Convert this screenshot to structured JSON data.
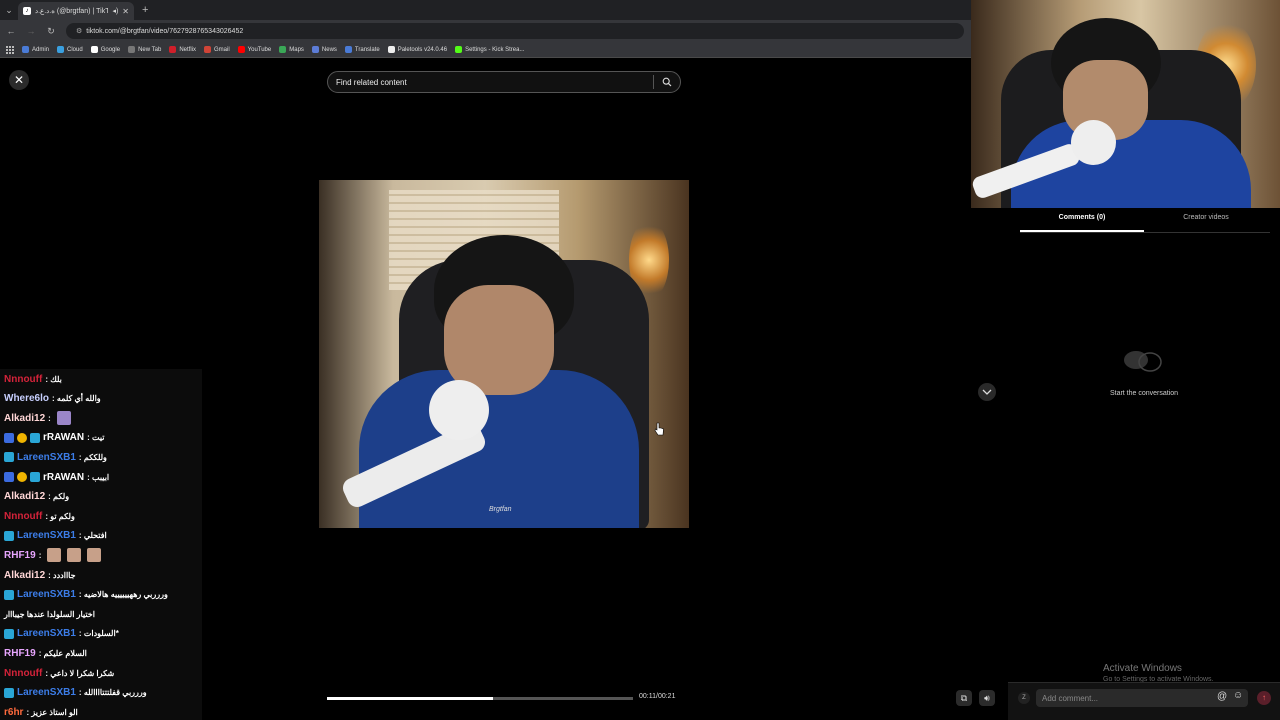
{
  "browser": {
    "tab_title": "ه.د.ع.د (@brgtfan) | TikTok",
    "url": "tiktok.com/@brgtfan/video/7627928765343026452",
    "bookmarks": [
      "Admin",
      "Cloud",
      "Google",
      "New Tab",
      "Netflix",
      "Gmail",
      "YouTube",
      "Maps",
      "News",
      "Translate",
      "Paletools v24.0.46",
      "Settings - Kick Strea..."
    ],
    "bookmark_colors": [
      "#4a7bd6",
      "#3aa0e0",
      "#ffffff",
      "#777777",
      "#d01f2a",
      "#d04437",
      "#ff0000",
      "#3aa757",
      "#5c7cd6",
      "#4a7bd6",
      "#eeeeee",
      "#53fc18"
    ]
  },
  "search": {
    "placeholder": "Find related content"
  },
  "video": {
    "watermark": "Brgtfan",
    "time": "00:11/00:21",
    "progress": 0.543
  },
  "chat": [
    {
      "user": "Nnnouff",
      "color": "#d4233a",
      "badges": [],
      "msg": ": بلك"
    },
    {
      "user": "Where6lo",
      "color": "#c8d0ff",
      "badges": [],
      "msg": ": والله أي كلمه"
    },
    {
      "user": "Alkadi12",
      "color": "#ffd6d6",
      "badges": [],
      "msg": ":",
      "emote": "purple"
    },
    {
      "user": "rRAWAN",
      "color": "#ffffff",
      "badges": [
        "mod",
        "vip",
        "sub"
      ],
      "msg": ": تيت"
    },
    {
      "user": "LareenSXB1",
      "color": "#3c7de8",
      "badges": [
        "sub"
      ],
      "msg": ": وللككم"
    },
    {
      "user": "rRAWAN",
      "color": "#ffffff",
      "badges": [
        "mod",
        "vip",
        "sub"
      ],
      "msg": ": ابيبب"
    },
    {
      "user": "Alkadi12",
      "color": "#ffd6d6",
      "badges": [],
      "msg": ": ولكم"
    },
    {
      "user": "Nnnouff",
      "color": "#d4233a",
      "badges": [],
      "msg": ": ولكم تو"
    },
    {
      "user": "LareenSXB1",
      "color": "#3c7de8",
      "badges": [
        "sub"
      ],
      "msg": ": افتحلي"
    },
    {
      "user": "RHF19",
      "color": "#e8a6ff",
      "badges": [],
      "msg": ":",
      "emote": "faces"
    },
    {
      "user": "Alkadi12",
      "color": "#ffd6d6",
      "badges": [],
      "msg": ": جاااددد"
    },
    {
      "user": "LareenSXB1",
      "color": "#3c7de8",
      "badges": [
        "sub"
      ],
      "msg": ": وررربي رههييييييه هالاضيه"
    },
    {
      "user": "",
      "color": "#ffffff",
      "badges": [],
      "msg": "اختيار السلولدا عندها جيبااار"
    },
    {
      "user": "LareenSXB1",
      "color": "#3c7de8",
      "badges": [
        "sub"
      ],
      "msg": ": السلودات*"
    },
    {
      "user": "RHF19",
      "color": "#e8a6ff",
      "badges": [],
      "msg": ": السلام عليكم"
    },
    {
      "user": "Nnnouff",
      "color": "#d4233a",
      "badges": [],
      "msg": ": شكرا شكرا لا داعي"
    },
    {
      "user": "LareenSXB1",
      "color": "#3c7de8",
      "badges": [
        "sub"
      ],
      "msg": ": وررربي قفلتتتاااالله"
    },
    {
      "user": "r6hr",
      "color": "#ff6a3d",
      "badges": [],
      "msg": ": الو استاذ عزيز"
    }
  ],
  "panel": {
    "tabs": [
      "Comments (0)",
      "Creator videos"
    ],
    "active_tab": 0,
    "empty_text": "Start the conversation",
    "comment_placeholder": "Add comment...",
    "avatar_letter": "Z"
  },
  "watermark": {
    "title": "Activate Windows",
    "subtitle": "Go to Settings to activate Windows."
  }
}
